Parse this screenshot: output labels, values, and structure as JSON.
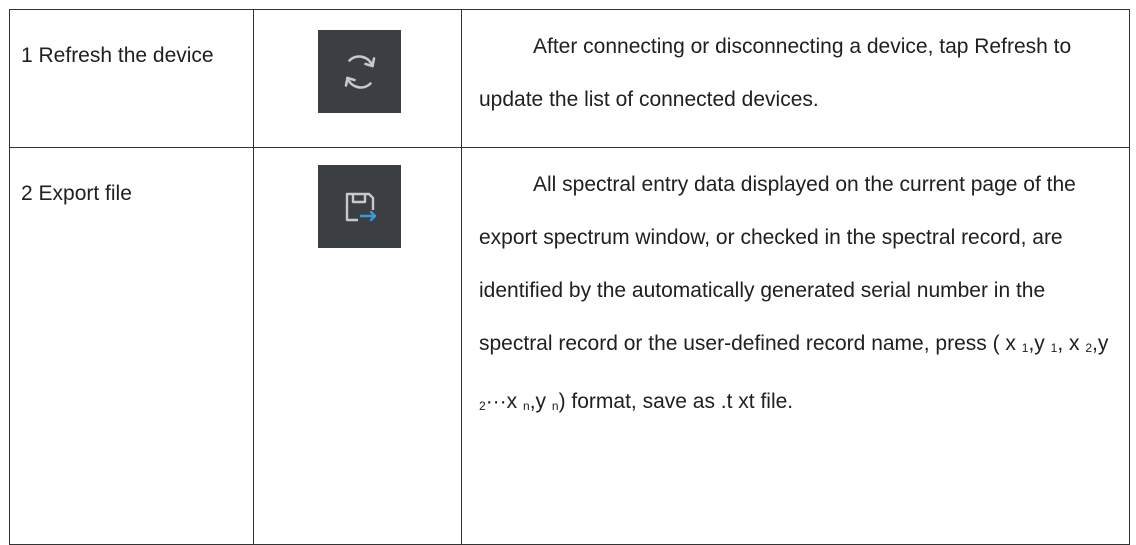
{
  "rows": [
    {
      "name": "1 Refresh the device",
      "icon": "refresh-icon",
      "description": "After connecting or disconnecting a device, tap Refresh to update the list of connected devices."
    },
    {
      "name": "2 Export file",
      "icon": "export-file-icon",
      "description_main": "All spectral entry data displayed on the current page of the export spectrum window, or checked in the spectral record, are identified by the automatically generated serial number in the spectral record or the user-defined record name, press ( x",
      "format": {
        "sub1": "1",
        "sep1": ",y",
        "sub2": "1",
        "sep2": ", x",
        "sub3": "2",
        "sep3": ",y",
        "sub4": "2",
        "sep4": "···x",
        "sub5": "n",
        "sep5": ",y",
        "sub6": "n"
      },
      "description_tail": ") format, save as .t xt file."
    }
  ],
  "colors": {
    "icon_background": "#3b3f43",
    "icon_stroke": "#c8c8c8",
    "icon_accent": "#3a9ad9",
    "border": "#333333"
  }
}
